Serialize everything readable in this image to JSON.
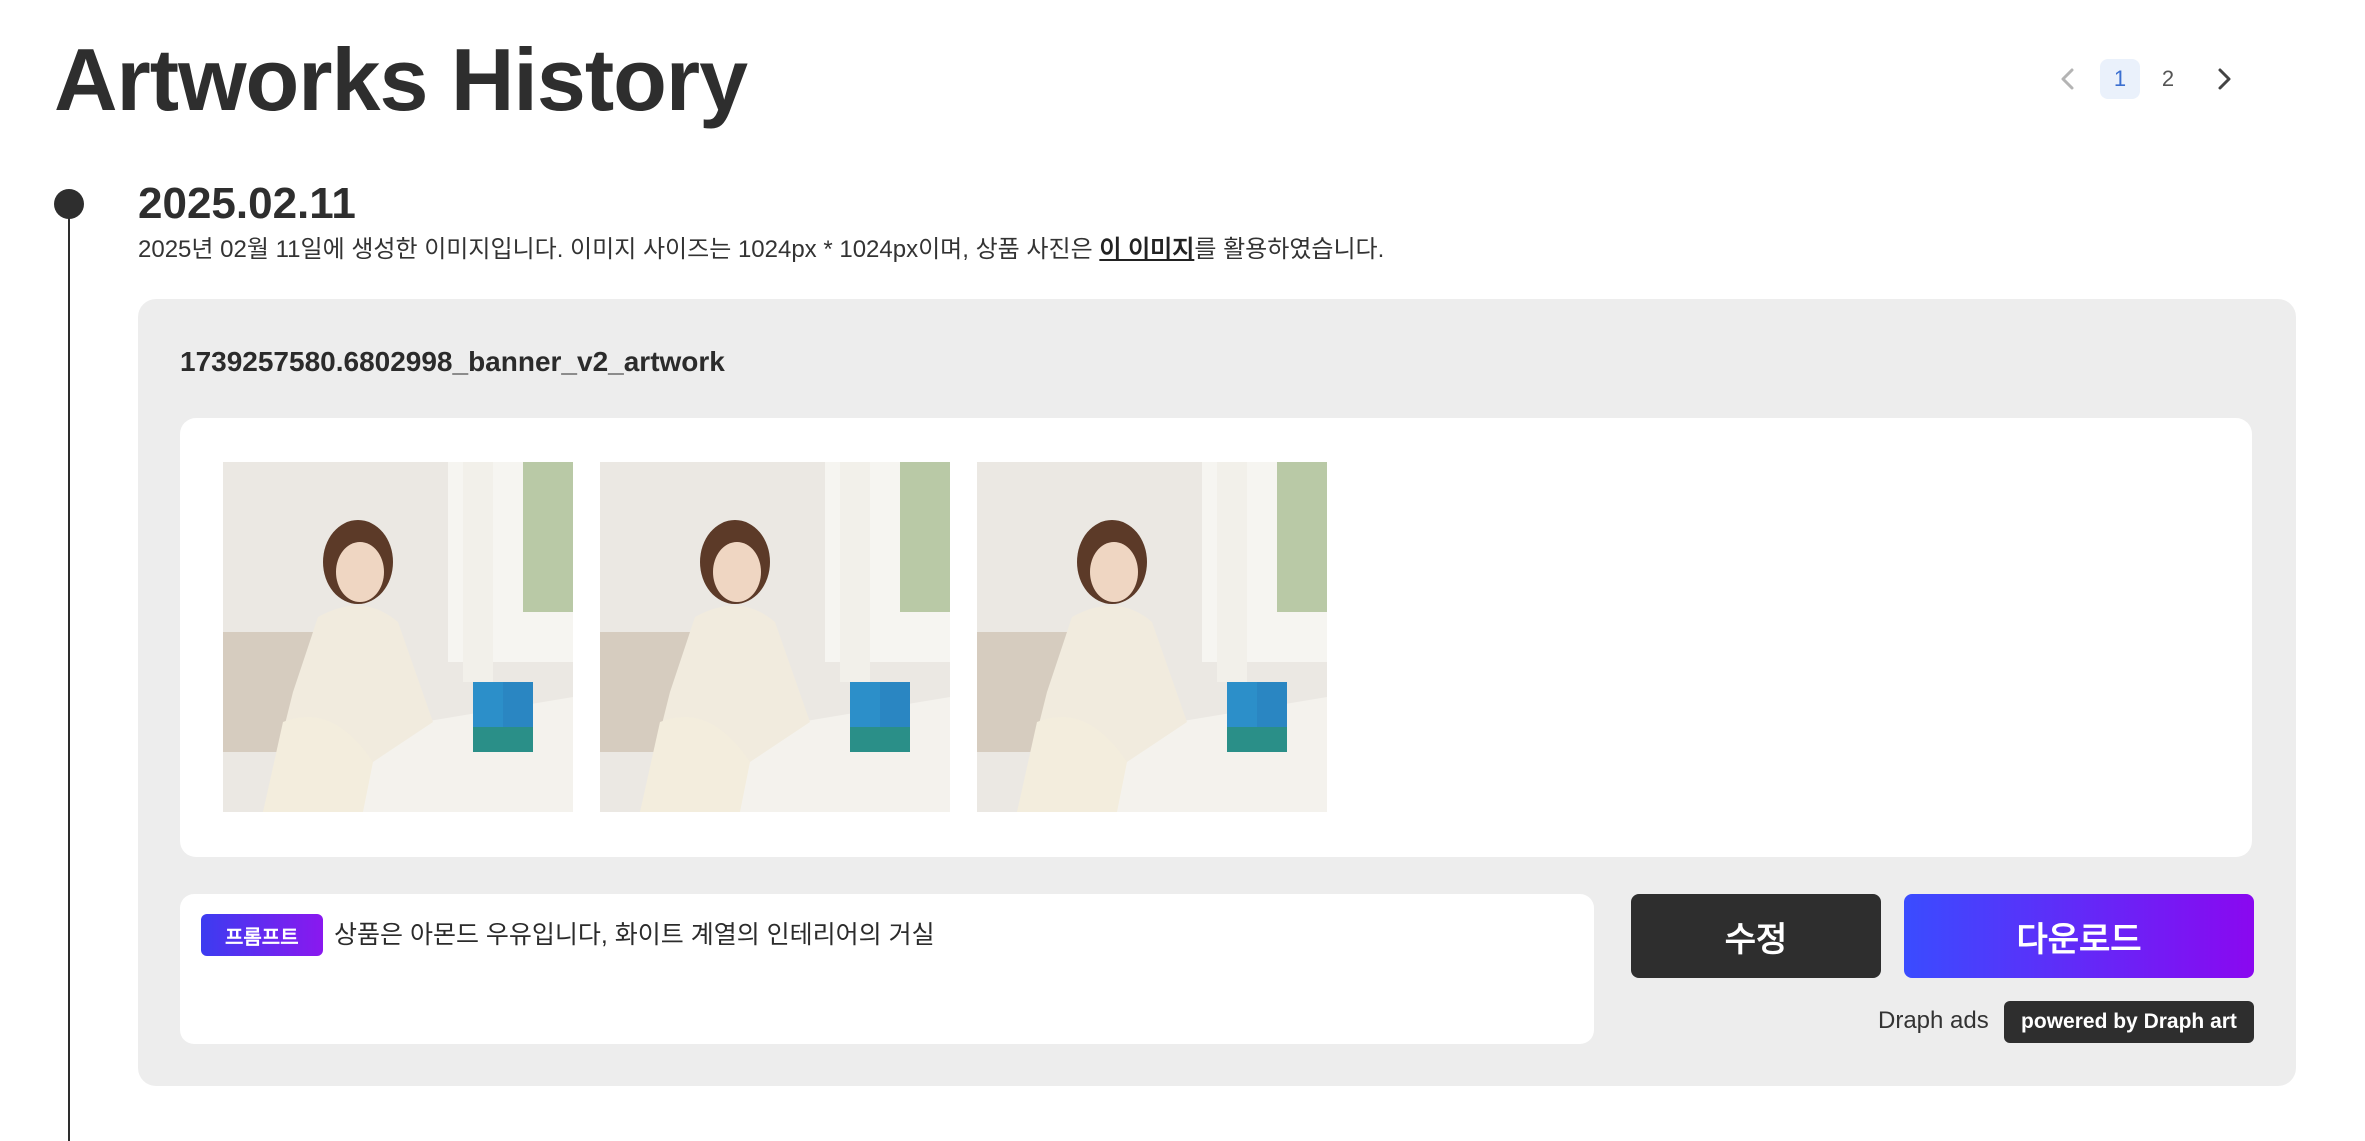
{
  "page": {
    "title": "Artworks History"
  },
  "pagination": {
    "prev_icon": "chevron-left-icon",
    "next_icon": "chevron-right-icon",
    "pages": [
      "1",
      "2"
    ],
    "current": "1"
  },
  "entry": {
    "date": "2025.02.11",
    "description_before": "2025년 02월 11일에 생성한 이미지입니다. 이미지 사이즈는 1024px * 1024px이며, 상품 사진은 ",
    "description_link": "이 이미지",
    "description_after": "를 활용하였습니다."
  },
  "artwork": {
    "name": "1739257580.6802998_banner_v2_artwork",
    "prompt_badge": "프롬프트",
    "prompt_text": "상품은 아몬드 우유입니다, 화이트 계열의 인테리어의 거실",
    "edit_label": "수정",
    "download_label": "다운로드",
    "ads_label": "Draph ads",
    "powered_label": "powered by Draph art"
  },
  "colors": {
    "accent_start": "#3a4cff",
    "accent_end": "#8a08f0",
    "dark": "#2e2e2e",
    "card_bg": "#ededed",
    "active_page_bg": "#eaf1fb"
  }
}
